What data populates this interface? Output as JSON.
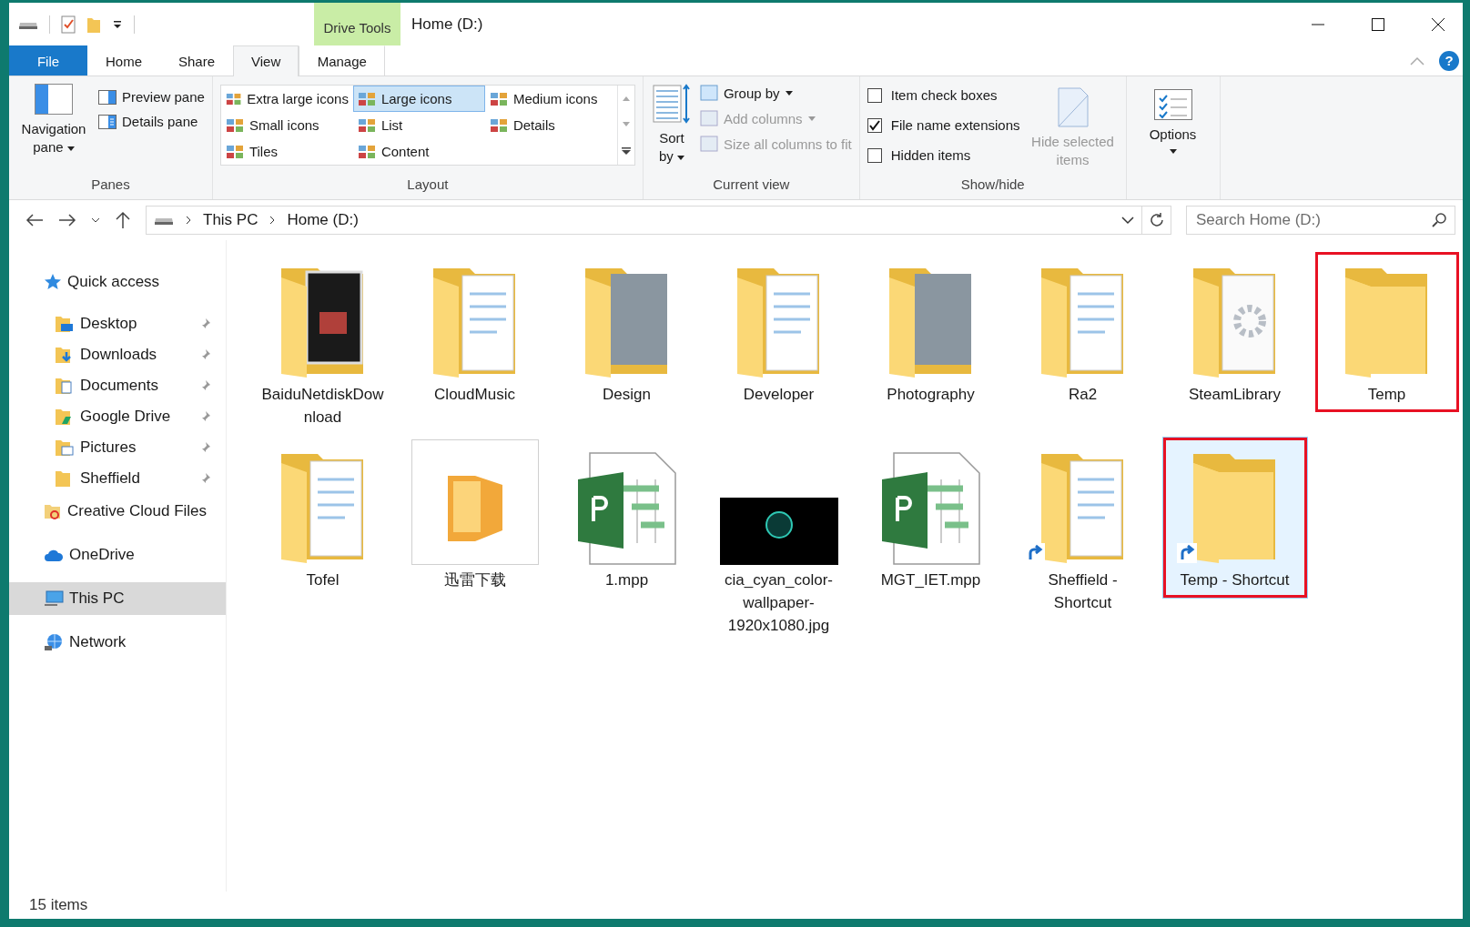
{
  "window": {
    "title": "Home (D:)",
    "context_tab": "Drive Tools"
  },
  "ribbon_tabs": [
    {
      "label": "File",
      "kind": "file",
      "selected": false
    },
    {
      "label": "Home",
      "kind": "tab",
      "selected": false
    },
    {
      "label": "Share",
      "kind": "tab",
      "selected": false
    },
    {
      "label": "View",
      "kind": "tab",
      "selected": true
    },
    {
      "label": "Manage",
      "kind": "context",
      "selected": false
    }
  ],
  "panes_group": {
    "label": "Panes",
    "navigation_pane": "Navigation pane",
    "preview_pane": "Preview pane",
    "details_pane": "Details pane"
  },
  "layout_group": {
    "label": "Layout",
    "options": [
      {
        "label": "Extra large icons",
        "selected": false
      },
      {
        "label": "Large icons",
        "selected": true
      },
      {
        "label": "Medium icons",
        "selected": false
      },
      {
        "label": "Small icons",
        "selected": false
      },
      {
        "label": "List",
        "selected": false
      },
      {
        "label": "Details",
        "selected": false
      },
      {
        "label": "Tiles",
        "selected": false
      },
      {
        "label": "Content",
        "selected": false
      }
    ]
  },
  "current_view_group": {
    "label": "Current view",
    "sort_by": "Sort by",
    "commands": [
      {
        "label": "Group by",
        "disabled": false,
        "dropdown": true
      },
      {
        "label": "Add columns",
        "disabled": true,
        "dropdown": true
      },
      {
        "label": "Size all columns to fit",
        "disabled": true,
        "dropdown": false
      }
    ]
  },
  "show_hide_group": {
    "label": "Show/hide",
    "checkboxes": [
      {
        "label": "Item check boxes",
        "checked": false
      },
      {
        "label": "File name extensions",
        "checked": true
      },
      {
        "label": "Hidden items",
        "checked": false
      }
    ],
    "hide_selected": {
      "label": "Hide selected items",
      "disabled": true
    }
  },
  "options_button": {
    "label": "Options"
  },
  "help_button": {
    "label": "?"
  },
  "address_bar": {
    "crumbs": [
      "This PC",
      "Home (D:)"
    ]
  },
  "search": {
    "placeholder": "Search Home (D:)"
  },
  "navigation": [
    {
      "label": "Quick access",
      "kind": "star",
      "selected": false,
      "children": [
        {
          "label": "Desktop",
          "kind": "desktop",
          "pinned": true,
          "selected": false
        },
        {
          "label": "Downloads",
          "kind": "downloads",
          "pinned": true,
          "selected": false
        },
        {
          "label": "Documents",
          "kind": "documents",
          "pinned": true,
          "selected": false
        },
        {
          "label": "Google Drive",
          "kind": "drive",
          "pinned": true,
          "selected": false
        },
        {
          "label": "Pictures",
          "kind": "pictures",
          "pinned": true,
          "selected": false
        },
        {
          "label": "Sheffield",
          "kind": "folder",
          "pinned": true,
          "selected": false
        }
      ]
    },
    {
      "label": "Creative Cloud Files",
      "kind": "creative",
      "selected": false
    },
    {
      "label": "OneDrive",
      "kind": "cloud",
      "selected": false
    },
    {
      "label": "This PC",
      "kind": "pc",
      "selected": true
    },
    {
      "label": "Network",
      "kind": "network",
      "selected": false
    }
  ],
  "files": [
    {
      "name": "BaiduNetdiskDownload",
      "kind": "folder-dark",
      "shortcut": false,
      "selected": false,
      "highlighted": false
    },
    {
      "name": "CloudMusic",
      "kind": "folder-docs",
      "shortcut": false,
      "selected": false,
      "highlighted": false
    },
    {
      "name": "Design",
      "kind": "folder-photo",
      "shortcut": false,
      "selected": false,
      "highlighted": false
    },
    {
      "name": "Developer",
      "kind": "folder-docs",
      "shortcut": false,
      "selected": false,
      "highlighted": false
    },
    {
      "name": "Photography",
      "kind": "folder-photo",
      "shortcut": false,
      "selected": false,
      "highlighted": false
    },
    {
      "name": "Ra2",
      "kind": "folder-docs",
      "shortcut": false,
      "selected": false,
      "highlighted": false
    },
    {
      "name": "SteamLibrary",
      "kind": "folder-gear",
      "shortcut": false,
      "selected": false,
      "highlighted": false
    },
    {
      "name": "Temp",
      "kind": "folder",
      "shortcut": false,
      "selected": false,
      "highlighted": true
    },
    {
      "name": "Tofel",
      "kind": "folder-docs",
      "shortcut": false,
      "selected": false,
      "highlighted": false
    },
    {
      "name": "迅雷下载",
      "kind": "app-folder",
      "shortcut": false,
      "selected": false,
      "highlighted": false
    },
    {
      "name": "1.mpp",
      "kind": "project",
      "shortcut": false,
      "selected": false,
      "highlighted": false
    },
    {
      "name": "cia_cyan_color-wallpaper-1920x1080.jpg",
      "kind": "image",
      "shortcut": false,
      "selected": false,
      "highlighted": false
    },
    {
      "name": "MGT_IET.mpp",
      "kind": "project",
      "shortcut": false,
      "selected": false,
      "highlighted": false
    },
    {
      "name": "Sheffield - Shortcut",
      "kind": "folder-docs",
      "shortcut": true,
      "selected": false,
      "highlighted": false
    },
    {
      "name": "Temp - Shortcut",
      "kind": "folder",
      "shortcut": true,
      "selected": true,
      "highlighted": true
    }
  ],
  "status_bar": {
    "count": "15 items"
  }
}
